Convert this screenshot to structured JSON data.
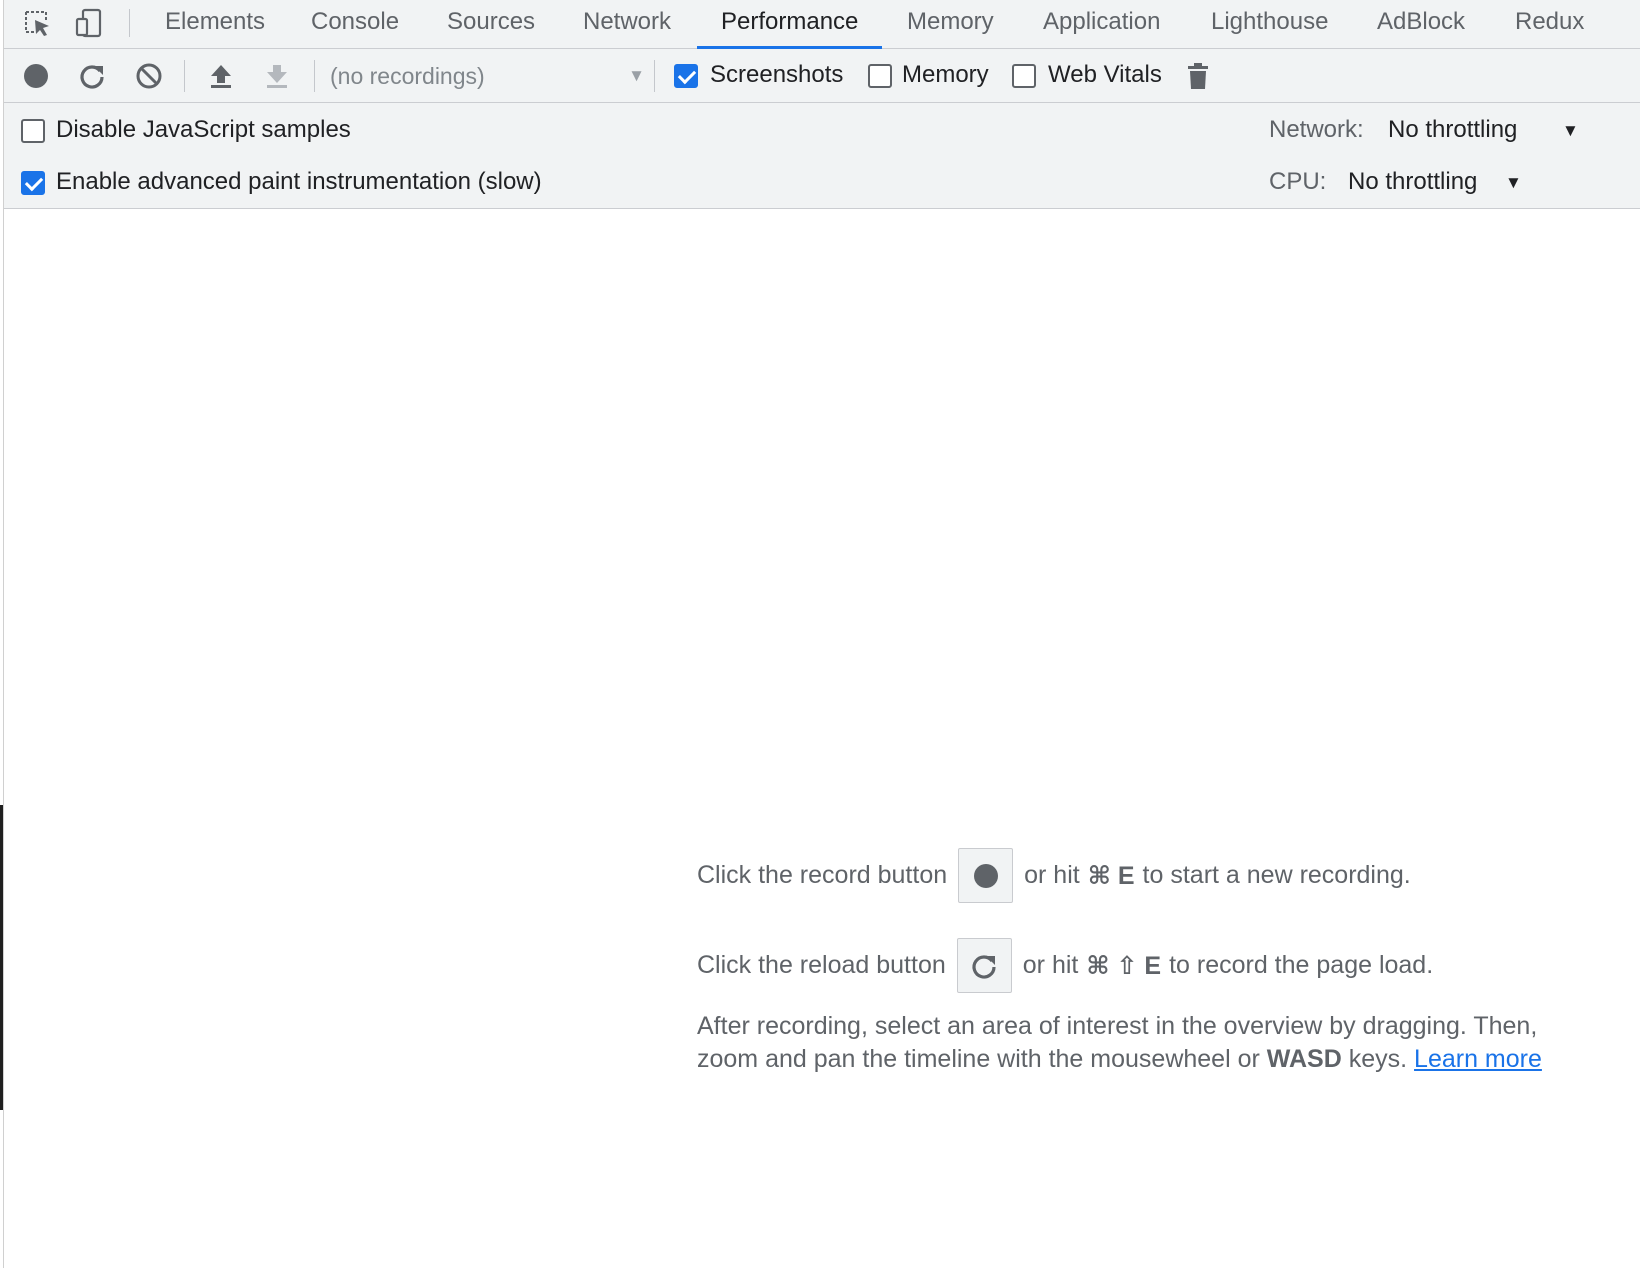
{
  "tabs": [
    {
      "label": "Elements",
      "active": false
    },
    {
      "label": "Console",
      "active": false
    },
    {
      "label": "Sources",
      "active": false
    },
    {
      "label": "Network",
      "active": false
    },
    {
      "label": "Performance",
      "active": true
    },
    {
      "label": "Memory",
      "active": false
    },
    {
      "label": "Application",
      "active": false
    },
    {
      "label": "Lighthouse",
      "active": false
    },
    {
      "label": "AdBlock",
      "active": false
    },
    {
      "label": "Redux",
      "active": false
    }
  ],
  "toolbar": {
    "record_icon": "record-icon",
    "reload_icon": "reload-icon",
    "clear_icon": "clear-icon",
    "load_profile_icon": "upload-icon",
    "save_profile_icon": "download-icon",
    "recordings_select": "(no recordings)",
    "screenshots": {
      "label": "Screenshots",
      "checked": true
    },
    "memory": {
      "label": "Memory",
      "checked": false
    },
    "web_vitals": {
      "label": "Web Vitals",
      "checked": false
    },
    "trash_icon": "trash-icon"
  },
  "settings": {
    "disable_js_samples": {
      "label": "Disable JavaScript samples",
      "checked": false
    },
    "advanced_paint": {
      "label": "Enable advanced paint instrumentation (slow)",
      "checked": true
    },
    "network_label": "Network:",
    "network_value": "No throttling",
    "cpu_label": "CPU:",
    "cpu_value": "No throttling"
  },
  "landing": {
    "record_prefix": "Click the record button",
    "record_suffix_1": "or hit",
    "record_shortcut": "⌘ E",
    "record_suffix_2": "to start a new recording.",
    "reload_prefix": "Click the reload button",
    "reload_suffix_1": "or hit",
    "reload_shortcut": "⌘ ⇧ E",
    "reload_suffix_2": "to record the page load.",
    "para_1": "After recording, select an area of interest in the overview by dragging. Then, zoom and pan the timeline with the mousewheel or",
    "para_bold": "WASD",
    "para_2": "keys.",
    "learn_more": "Learn more"
  },
  "colors": {
    "accent": "#1a73e8",
    "toolbar_bg": "#f1f3f4",
    "muted_text": "#5f6368"
  }
}
